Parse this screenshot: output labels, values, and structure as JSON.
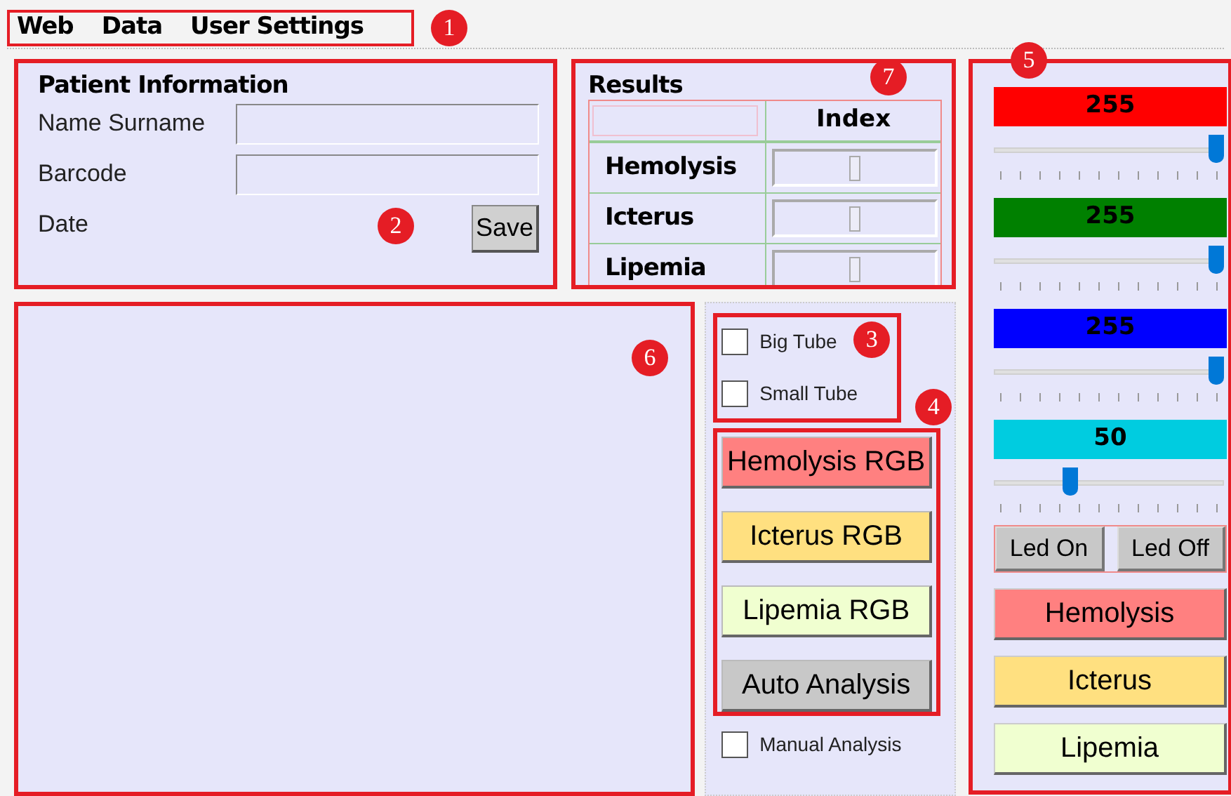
{
  "menu": {
    "callout": "1",
    "items": [
      "Web",
      "Data",
      "User Settings"
    ]
  },
  "patient_information": {
    "title": "Patient Information",
    "callout": "2",
    "fields": [
      {
        "label": "Name Surname",
        "kind": "input"
      },
      {
        "label": "Barcode",
        "kind": "input"
      },
      {
        "label": "Date",
        "kind": "text"
      }
    ],
    "save_button": "Save"
  },
  "results": {
    "title": "Results",
    "callout": "7",
    "column_header": "Index",
    "rows": [
      {
        "label": "Hemolysis",
        "level": 0.5
      },
      {
        "label": "Icterus",
        "level": 0.5
      },
      {
        "label": "Lipemia",
        "level": 0.5
      }
    ]
  },
  "display_area": {
    "callout": "6"
  },
  "tube_options": {
    "callout": "3",
    "checkboxes": [
      {
        "label": "Big Tube",
        "checked": false
      },
      {
        "label": "Small Tube",
        "checked": false
      }
    ]
  },
  "rgb_buttons": {
    "callout": "4",
    "buttons": [
      {
        "label": "Hemolysis RGB",
        "color": "#ff8080"
      },
      {
        "label": "Icterus RGB",
        "color": "#ffe080"
      },
      {
        "label": "Lipemia RGB",
        "color": "#f0ffd0"
      },
      {
        "label": "Auto Analysis",
        "color": "#c8c8c8"
      }
    ]
  },
  "manual_analysis": {
    "label": "Manual Analysis",
    "checked": false
  },
  "led_panel": {
    "callout": "5",
    "channels": [
      {
        "value": "255",
        "color": "#ff0000",
        "level": 1
      },
      {
        "value": "255",
        "color": "#008000",
        "level": 1
      },
      {
        "value": "255",
        "color": "#0000ff",
        "level": 1
      },
      {
        "value": "50",
        "color": "#00cce0",
        "level": 0.32
      }
    ],
    "led_buttons": [
      "Led On",
      "Led Off"
    ],
    "result_buttons": [
      {
        "label": "Hemolysis",
        "color": "#ff8080"
      },
      {
        "label": "Icterus",
        "color": "#ffe080"
      },
      {
        "label": "Lipemia",
        "color": "#f0ffd0"
      }
    ]
  }
}
